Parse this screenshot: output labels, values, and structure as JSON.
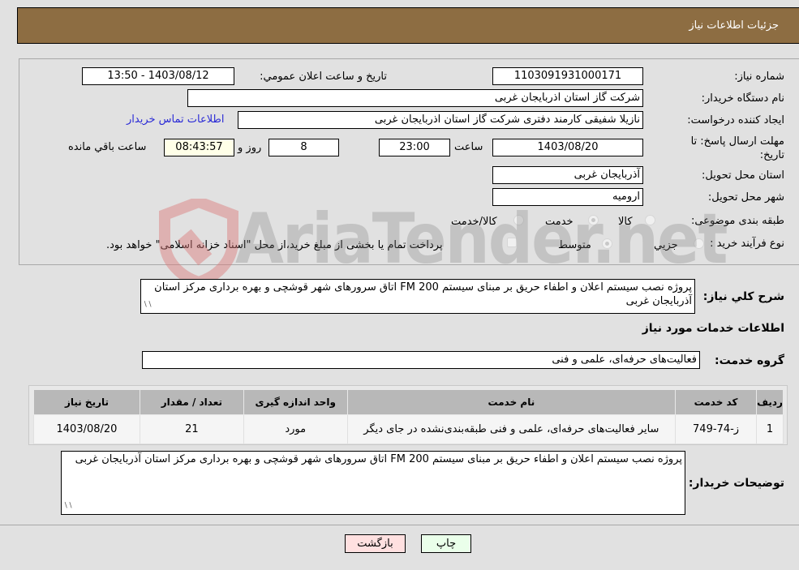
{
  "header": {
    "title": "جزئیات اطلاعات نیاز"
  },
  "form": {
    "need_number": {
      "label": "شماره نیاز:",
      "value": "1103091931000171"
    },
    "announce_datetime": {
      "label": "تاریخ و ساعت اعلان عمومي:",
      "value": "1403/08/12 - 13:50"
    },
    "buyer_org": {
      "label": "نام دستگاه خريدار:",
      "value": "شرکت گاز استان اذربایجان غربی"
    },
    "requester": {
      "label": "ايجاد کننده درخواست:",
      "value": "نازیلا شفیقی کارمند دفتری شرکت گاز استان اذربایجان غربی"
    },
    "buyer_contact_link": "اطلاعات تماس خريدار",
    "deadline": {
      "label": "مهلت ارسال پاسخ: تا تاريخ:",
      "date": "1403/08/20",
      "time_label": "ساعت",
      "time": "23:00",
      "days": "8",
      "days_label": "روز و",
      "remaining": "08:43:57",
      "remaining_label": "ساعت باقي مانده"
    },
    "delivery_province": {
      "label": "استان محل تحويل:",
      "value": "آذربایجان غربی"
    },
    "delivery_city": {
      "label": "شهر محل تحويل:",
      "value": "ارومیه"
    },
    "category": {
      "label": "طبقه بندی موضوعی:",
      "options": [
        "کالا",
        "خدمت",
        "کالا/خدمت"
      ],
      "selected": "خدمت"
    },
    "purchase_type": {
      "label": "نوع فرآيند خريد :",
      "options": [
        "جزيي",
        "متوسط"
      ],
      "selected": "متوسط",
      "treasury_note": "پرداخت تمام يا بخشی از مبلغ خريد،از محل \"اسناد خزانه اسلامی\" خواهد بود.",
      "treasury_checked": false
    },
    "general_description": {
      "label": "شرح کلي نياز:",
      "value": "پروژه نصب سیستم اعلان و اطفاء حریق بر مبنای سیستم FM 200 اتاق  سرورهای شهر قوشچی و بهره برداری مرکز استان آذربایجان غربی"
    }
  },
  "services": {
    "section_title": "اطلاعات خدمات مورد نياز",
    "group_label": "گروه خدمت:",
    "group_value": "فعالیت‌های حرفه‌ای، علمی و فنی",
    "table": {
      "headers": [
        "رديف",
        "کد خدمت",
        "نام خدمت",
        "واحد اندازه گيری",
        "تعداد / مقدار",
        "تاريخ نياز"
      ],
      "rows": [
        [
          "1",
          "ز-74-749",
          "سایر فعالیت‌های حرفه‌ای، علمی و فنی طبقه‌بندی‌نشده در جای دیگر",
          "مورد",
          "21",
          "1403/08/20"
        ]
      ]
    }
  },
  "buyer_notes": {
    "label": "توضيحات خريدار:",
    "value": "پروژه نصب سیستم اعلان و اطفاء حریق بر مبنای سیستم FM 200 اتاق  سرورهای شهر قوشچی و بهره برداری مرکز استان آذربایجان غربی"
  },
  "buttons": {
    "print": "چاپ",
    "back": "بازگشت"
  },
  "watermark": {
    "text": "AriaTender.net"
  }
}
